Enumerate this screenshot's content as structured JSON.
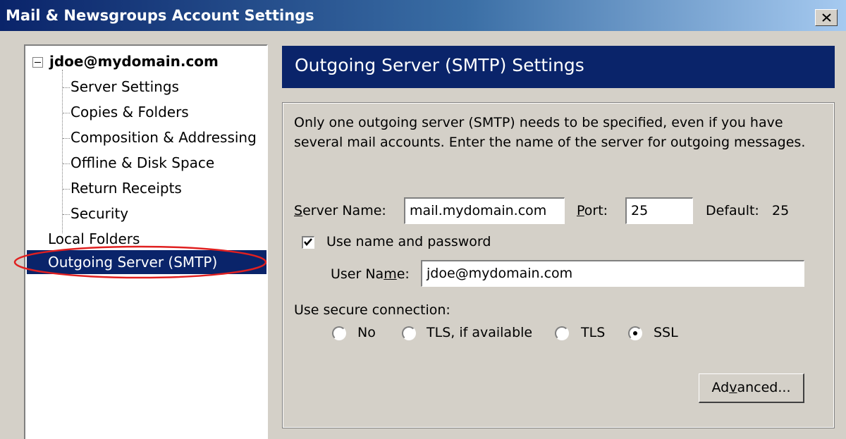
{
  "window": {
    "title": "Mail & Newsgroups Account Settings",
    "close_icon": "close-icon"
  },
  "tree": {
    "account": "jdoe@mydomain.com",
    "children": [
      "Server Settings",
      "Copies & Folders",
      "Composition & Addressing",
      "Offline & Disk Space",
      "Return Receipts",
      "Security"
    ],
    "local_folders": "Local Folders",
    "outgoing_server": "Outgoing Server (SMTP)"
  },
  "panel": {
    "header": "Outgoing Server (SMTP) Settings",
    "description": "Only one outgoing server (SMTP) needs to be specified, even if you have several mail accounts. Enter the name of the server for outgoing messages.",
    "server_name_label_u": "S",
    "server_name_label_rest": "erver Name:",
    "server_name_value": "mail.mydomain.com",
    "port_label_u": "P",
    "port_label_rest": "ort:",
    "port_value": "25",
    "default_label": "Default:",
    "default_value": "25",
    "use_name_password_label": "Use name and password",
    "use_name_password_checked": true,
    "user_name_label_pre": "User Na",
    "user_name_label_u": "m",
    "user_name_label_post": "e:",
    "user_name_value": "jdoe@mydomain.com",
    "secure_label": "Use secure connection:",
    "radio_options": [
      "No",
      "TLS, if available",
      "TLS",
      "SSL"
    ],
    "radio_selected": "SSL",
    "advanced_pre": "Ad",
    "advanced_u": "v",
    "advanced_post": "anced..."
  },
  "colors": {
    "title_gradient_start": "#0a246a",
    "header_band": "#0a246a",
    "selection": "#0a246a",
    "highlight_ellipse": "#e02020",
    "dialog_face": "#d4d0c8"
  }
}
